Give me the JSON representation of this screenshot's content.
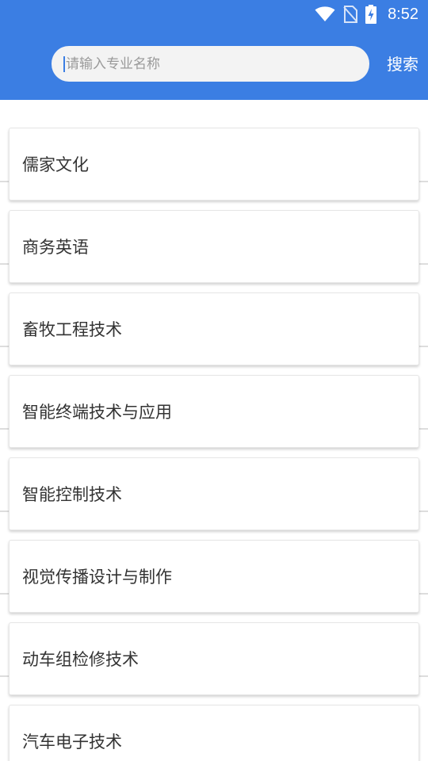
{
  "status_bar": {
    "time": "8:52",
    "icons": [
      "wifi-icon",
      "no-sim-icon",
      "battery-charging-icon"
    ]
  },
  "header": {
    "background_color": "#3b7ee3",
    "search": {
      "placeholder": "请输入专业名称",
      "value": ""
    },
    "search_button_label": "搜索"
  },
  "list": {
    "items": [
      {
        "label": "儒家文化"
      },
      {
        "label": "商务英语"
      },
      {
        "label": "畜牧工程技术"
      },
      {
        "label": "智能终端技术与应用"
      },
      {
        "label": "智能控制技术"
      },
      {
        "label": "视觉传播设计与制作"
      },
      {
        "label": "动车组检修技术"
      },
      {
        "label": "汽车电子技术"
      }
    ]
  }
}
